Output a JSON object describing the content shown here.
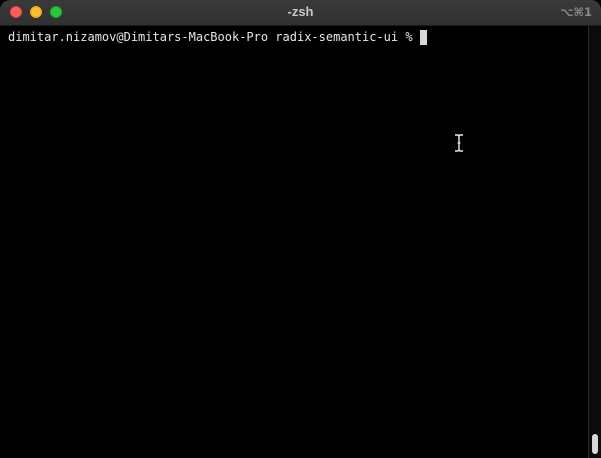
{
  "window": {
    "title": "-zsh",
    "shortcut": "⌥⌘1",
    "traffic_lights": {
      "close": "#ff5f57",
      "minimize": "#febc2e",
      "zoom": "#28c840"
    }
  },
  "terminal": {
    "prompt": "dimitar.nizamov@Dimitars-MacBook-Pro radix-semantic-ui % ",
    "background": "#000000",
    "foreground": "#e6e6e6"
  },
  "icons": {
    "text_cursor": "i-beam-cursor-icon"
  }
}
